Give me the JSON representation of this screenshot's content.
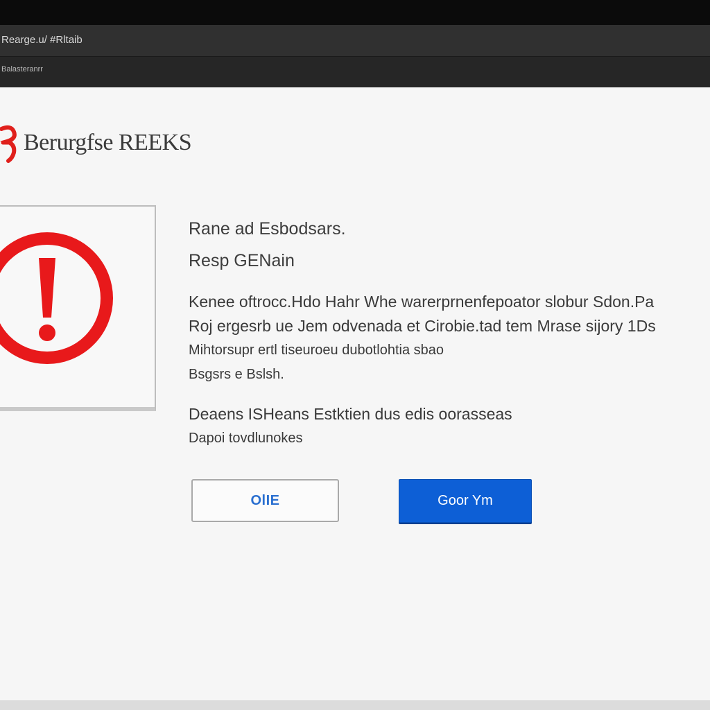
{
  "window": {
    "title": "Rearge.u/ #Rltaib",
    "toolbar_text": "Balasteranrr"
  },
  "brand": {
    "name": "Berurgfse REEKS",
    "logo_color": "#e0201c"
  },
  "alert": {
    "icon": "exclamation-circle-icon",
    "color": "#e8191b",
    "heading": "Rane ad Esbodsars.",
    "subheading": "Resp GENain",
    "body_lines": [
      "Kenee oftrocc.Hdo Hahr Whe warerprnenfepoator slobur Sdon.Pa",
      "Roj ergesrb ue Jem odvenada et Cirobie.tad tem Mrase sijory 1Ds",
      "Mihtorsupr ertl tiseuroeu dubotlohtia sbao",
      "Bsgsrs e Bslsh."
    ],
    "extra_lines": [
      "Deaens ISHeans Estktien dus edis oorasseas",
      "Dapoi tovdlunokes"
    ]
  },
  "buttons": {
    "secondary_label": "OlIE",
    "primary_label": "Goor Ym"
  }
}
